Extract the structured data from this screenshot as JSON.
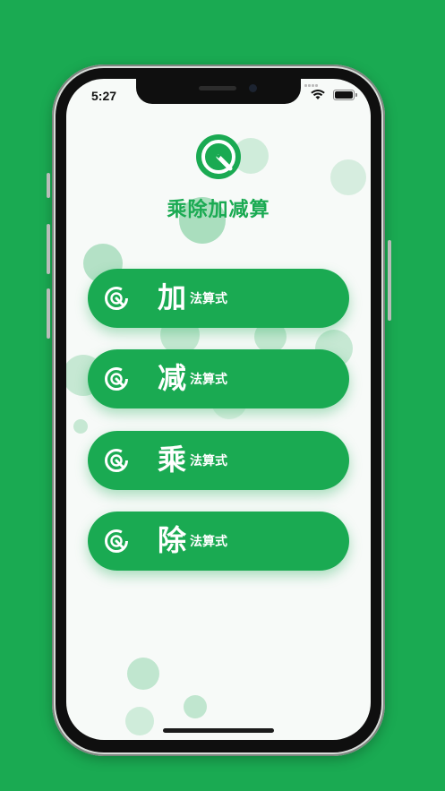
{
  "status_bar": {
    "time": "5:27"
  },
  "app": {
    "title": "乘除加减算"
  },
  "menu": [
    {
      "big": "加",
      "small": "法算式"
    },
    {
      "big": "减",
      "small": "法算式"
    },
    {
      "big": "乘",
      "small": "法算式"
    },
    {
      "big": "除",
      "small": "法算式"
    }
  ],
  "colors": {
    "brand_green": "#1aaa52",
    "screen_bg": "#f7faf8"
  },
  "icons": [
    "logo-icon",
    "wifi-icon",
    "battery-icon",
    "refresh-ring-icon"
  ]
}
